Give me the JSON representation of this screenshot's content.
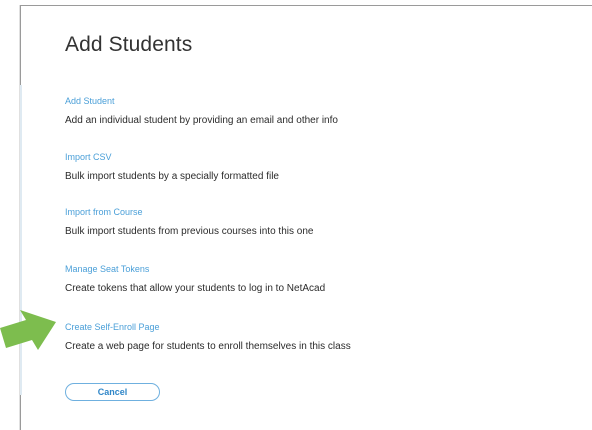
{
  "dialog": {
    "title": "Add Students"
  },
  "options": [
    {
      "link": "Add Student",
      "description": "Add an individual student by providing an email and other info"
    },
    {
      "link": "Import CSV",
      "description": "Bulk import students by a specially formatted file"
    },
    {
      "link": "Import from Course",
      "description": "Bulk import students from previous courses into this one"
    },
    {
      "link": "Manage Seat Tokens",
      "description": "Create tokens that allow your students to log in to NetAcad"
    },
    {
      "link": "Create Self-Enroll Page",
      "description": "Create a web page for students to enroll themselves in this class"
    }
  ],
  "actions": {
    "cancel_label": "Cancel"
  },
  "annotation": {
    "arrow_icon": "green-arrow-icon",
    "arrow_color": "#7dbd4e",
    "points_to": "Create Self-Enroll Page"
  },
  "colors": {
    "link": "#4a9fd8",
    "text": "#2b2b2b",
    "title": "#333333",
    "button_border": "#6fb0df"
  }
}
